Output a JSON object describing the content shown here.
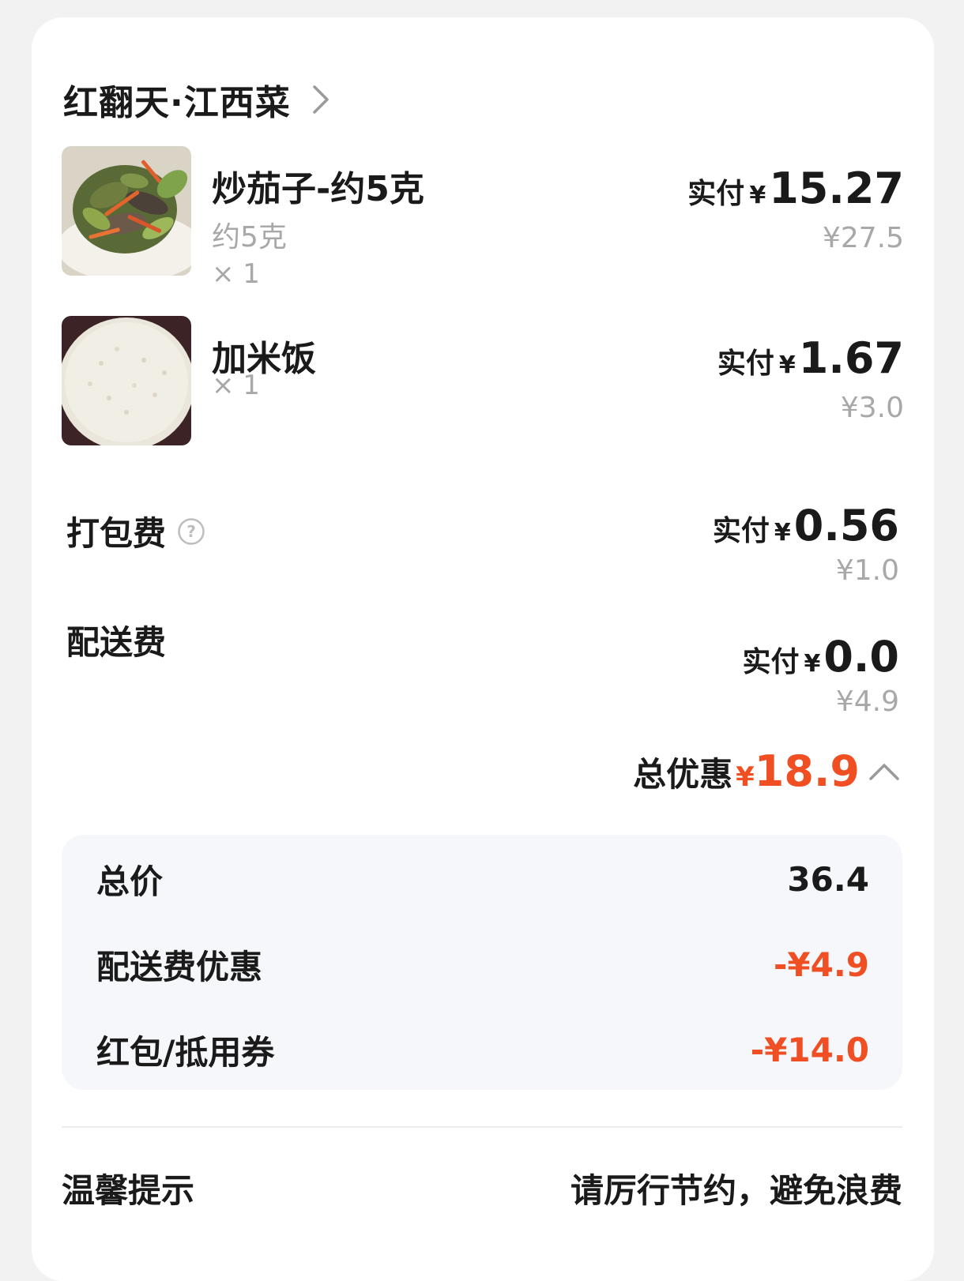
{
  "shop": {
    "name": "红翻天·江西菜"
  },
  "items": [
    {
      "name": "炒茄子-约5克",
      "spec": "约5克",
      "qty": "× 1",
      "paid_prefix": "实付",
      "yen": "¥",
      "paid": "15.27",
      "original": "¥27.5",
      "image": "stir-fried-eggplant-photo"
    },
    {
      "name": "加米饭",
      "qty": "× 1",
      "paid_prefix": "实付",
      "yen": "¥",
      "paid": "1.67",
      "original": "¥3.0",
      "image": "rice-bowl-photo"
    }
  ],
  "fees": [
    {
      "label": "打包费",
      "paid_prefix": "实付",
      "yen": "¥",
      "paid": "0.56",
      "original": "¥1.0",
      "icon": "help-circle-icon"
    },
    {
      "label": "配送费",
      "paid_prefix": "实付",
      "yen": "¥",
      "paid": "0.0",
      "original": "¥4.9"
    }
  ],
  "total_discount": {
    "label": "总优惠",
    "yen": "¥",
    "amount": "18.9",
    "icon": "chevron-up-icon"
  },
  "summary": [
    {
      "label": "总价",
      "value": "36.4",
      "highlight": false
    },
    {
      "label": "配送费优惠",
      "value": "-¥4.9",
      "highlight": true
    },
    {
      "label": "红包/抵用券",
      "value": "-¥14.0",
      "highlight": true
    }
  ],
  "tip": {
    "label": "温馨提示",
    "text": "请厉行节约，避免浪费"
  },
  "colors": {
    "accent_red": "#f04e23",
    "muted_text": "#a8a8a8",
    "summary_bg": "#f5f7fa"
  }
}
